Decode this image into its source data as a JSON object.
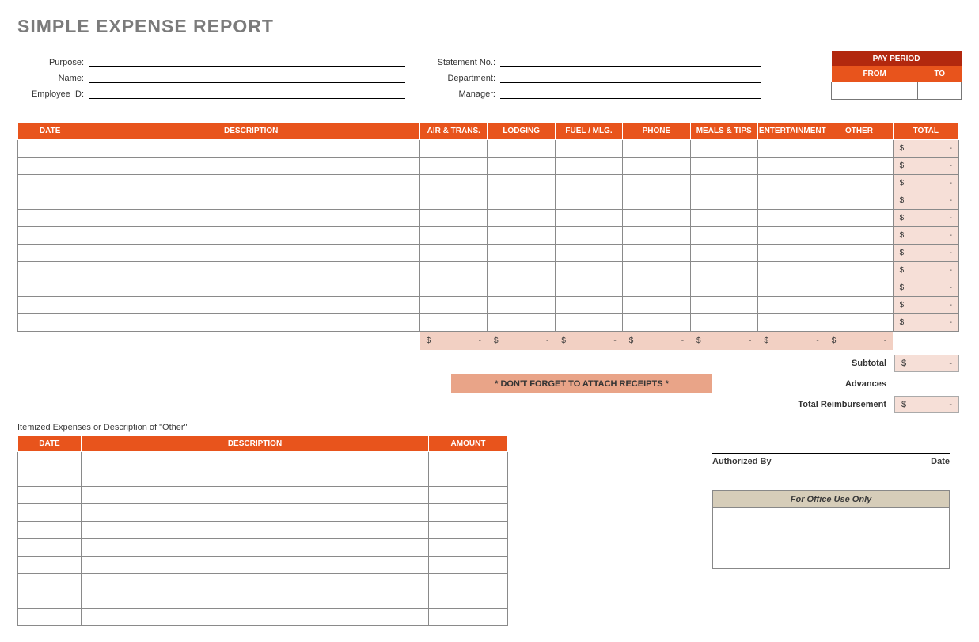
{
  "title": "SIMPLE EXPENSE REPORT",
  "meta": {
    "purpose_label": "Purpose:",
    "name_label": "Name:",
    "employee_id_label": "Employee ID:",
    "statement_no_label": "Statement No.:",
    "department_label": "Department:",
    "manager_label": "Manager:",
    "purpose_value": "",
    "name_value": "",
    "employee_id_value": "",
    "statement_no_value": "",
    "department_value": "",
    "manager_value": ""
  },
  "pay_period": {
    "title": "PAY PERIOD",
    "from_label": "FROM",
    "to_label": "TO",
    "from_value": "",
    "to_value": ""
  },
  "expense_headers": {
    "date": "DATE",
    "description": "DESCRIPTION",
    "air": "AIR & TRANS.",
    "lodging": "LODGING",
    "fuel": "FUEL / MLG.",
    "phone": "PHONE",
    "meals": "MEALS & TIPS",
    "ent": "ENTERTAINMENT",
    "other": "OTHER",
    "total": "TOTAL"
  },
  "expense_rows": 11,
  "row_total": {
    "sym": "$",
    "val": "-"
  },
  "column_subtotals": {
    "air": {
      "sym": "$",
      "val": "-"
    },
    "lodging": {
      "sym": "$",
      "val": "-"
    },
    "fuel": {
      "sym": "$",
      "val": "-"
    },
    "phone": {
      "sym": "$",
      "val": "-"
    },
    "meals": {
      "sym": "$",
      "val": "-"
    },
    "ent": {
      "sym": "$",
      "val": "-"
    },
    "other": {
      "sym": "$",
      "val": "-"
    }
  },
  "summary": {
    "subtotal_label": "Subtotal",
    "subtotal": {
      "sym": "$",
      "val": "-"
    },
    "advances_label": "Advances",
    "total_label": "Total Reimbursement",
    "total": {
      "sym": "$",
      "val": "-"
    }
  },
  "reminder": "* DON'T FORGET TO ATTACH RECEIPTS *",
  "other_caption": "Itemized Expenses or Description of \"Other\"",
  "other_headers": {
    "date": "DATE",
    "description": "DESCRIPTION",
    "amount": "AMOUNT"
  },
  "other_rows": 10,
  "sig": {
    "auth_label": "Authorized By",
    "date_label": "Date"
  },
  "office_use": "For Office Use Only"
}
